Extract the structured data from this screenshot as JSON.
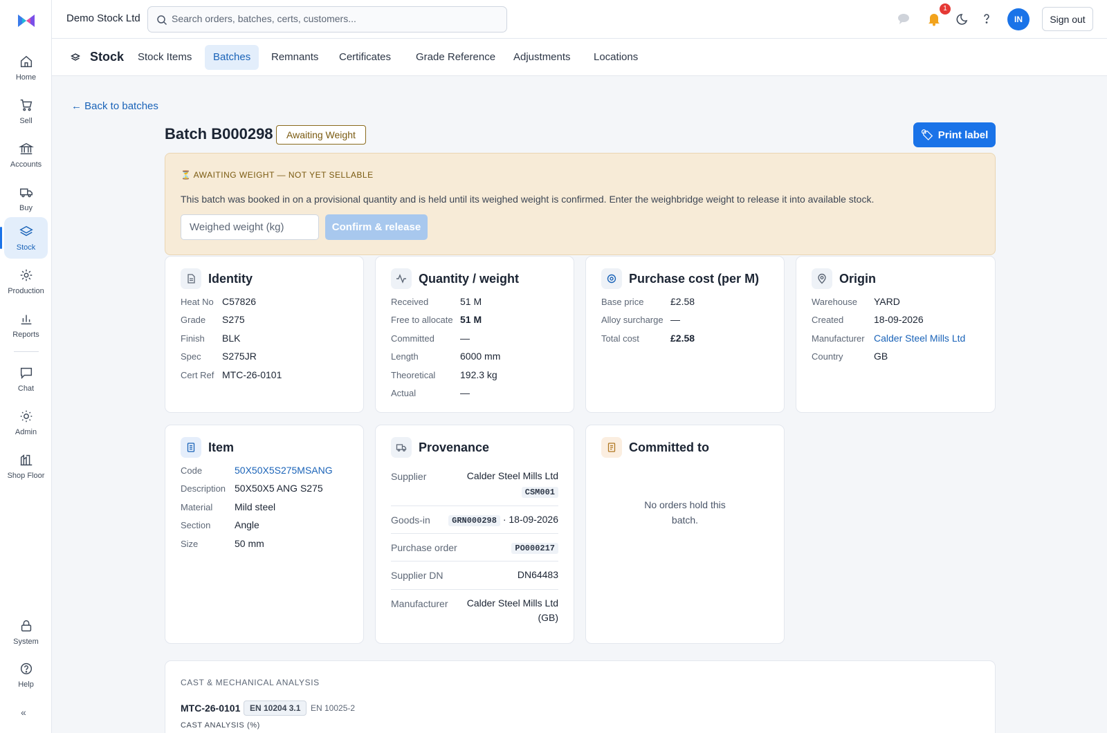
{
  "app": {
    "company": "Demo Stock Ltd",
    "search_placeholder": "Search orders, batches, certs, customers...",
    "notification_count": "1",
    "avatar_initials": "IN",
    "signout_label": "Sign out",
    "accent": "#1a73e8"
  },
  "sidebar": {
    "items": [
      {
        "label": "Home",
        "icon": "home-icon"
      },
      {
        "label": "Sell",
        "icon": "cart-icon"
      },
      {
        "label": "Accounts",
        "icon": "bank-icon"
      },
      {
        "label": "Buy",
        "icon": "truck-icon"
      },
      {
        "label": "Stock",
        "icon": "layers-icon",
        "active": true
      },
      {
        "label": "Production",
        "icon": "gear-icon"
      },
      {
        "label": "Reports",
        "icon": "bar-chart-icon"
      },
      {
        "label": "Chat",
        "icon": "chat-icon"
      },
      {
        "label": "Admin",
        "icon": "sun-gear-icon"
      },
      {
        "label": "Shop Floor",
        "icon": "factory-icon"
      },
      {
        "label": "System",
        "icon": "lock-icon"
      },
      {
        "label": "Help",
        "icon": "help-icon"
      }
    ],
    "collapse_label": "«"
  },
  "subnav": {
    "title": "Stock",
    "tabs": [
      "Stock Items",
      "Batches",
      "Remnants",
      "Certificates",
      "Grade Reference",
      "Adjustments",
      "Locations"
    ],
    "active_tab": "Batches"
  },
  "page": {
    "back_label": "← Back to batches",
    "title": "Batch B000298",
    "status": "Awaiting Weight",
    "print_label": "Print label"
  },
  "alert": {
    "heading": "AWAITING WEIGHT — NOT YET SELLABLE",
    "text": "This batch was booked in on a provisional quantity and is held until its weighed weight is confirmed. Enter the weighbridge weight to release it into available stock.",
    "input_placeholder": "Weighed weight (kg)",
    "confirm_label": "Confirm & release"
  },
  "identity": {
    "title": "Identity",
    "rows": [
      {
        "k": "Heat No",
        "v": "C57826"
      },
      {
        "k": "Grade",
        "v": "S275"
      },
      {
        "k": "Finish",
        "v": "BLK"
      },
      {
        "k": "Spec",
        "v": "S275JR"
      },
      {
        "k": "Cert Ref",
        "v": "MTC-26-0101"
      }
    ]
  },
  "quantity": {
    "title": "Quantity / weight",
    "rows": [
      {
        "k": "Received",
        "v": "51 M"
      },
      {
        "k": "Free to allocate",
        "v": "51 M"
      },
      {
        "k": "Committed",
        "v": "—"
      },
      {
        "k": "Length",
        "v": "6000 mm"
      },
      {
        "k": "Theoretical",
        "v": "192.3 kg"
      },
      {
        "k": "Actual",
        "v": "—"
      }
    ]
  },
  "purchase": {
    "title": "Purchase cost (per M)",
    "rows": [
      {
        "k": "Base price",
        "v": "£2.58"
      },
      {
        "k": "Alloy surcharge",
        "v": "—"
      },
      {
        "k": "Total cost",
        "v": "£2.58"
      }
    ]
  },
  "origin": {
    "title": "Origin",
    "rows": [
      {
        "k": "Warehouse",
        "v": "YARD"
      },
      {
        "k": "Created",
        "v": "18-09-2026"
      },
      {
        "k": "Manufacturer",
        "v": "Calder Steel Mills Ltd"
      },
      {
        "k": "Country",
        "v": "GB"
      }
    ]
  },
  "item": {
    "title": "Item",
    "rows": [
      {
        "k": "Code",
        "v": "50X50X5S275MSANG"
      },
      {
        "k": "Description",
        "v": "50X50X5 ANG S275"
      },
      {
        "k": "Material",
        "v": "Mild steel"
      },
      {
        "k": "Section",
        "v": "Angle"
      },
      {
        "k": "Size",
        "v": "50 mm"
      }
    ]
  },
  "provenance": {
    "title": "Provenance",
    "supplier_k": "Supplier",
    "supplier_v": "Calder Steel Mills Ltd",
    "supplier_code": "CSM001",
    "goodsin_k": "Goods-in",
    "goodsin_code": "GRN000298",
    "goodsin_date": "· 18-09-2026",
    "po_k": "Purchase order",
    "po_code": "PO000217",
    "dn_k": "Supplier DN",
    "dn_v": "DN64483",
    "mfr_k": "Manufacturer",
    "mfr_v1": "Calder Steel Mills Ltd",
    "mfr_v2": "(GB)"
  },
  "committed": {
    "title": "Committed to",
    "empty_line1": "No orders hold this",
    "empty_line2": "batch."
  },
  "analysis": {
    "heading": "CAST & MECHANICAL ANALYSIS",
    "cert": "MTC-26-0101",
    "cert_type": "EN 10204 3.1",
    "standard": "EN 10025-2",
    "sub_heading": "CAST ANALYSIS (%)"
  }
}
